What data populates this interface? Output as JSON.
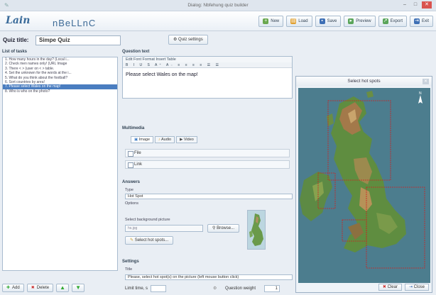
{
  "window": {
    "title": "Dialog: Nbfehung quiz builder"
  },
  "header": {
    "logo": "Lain",
    "logo_sub": "Nbfehung",
    "logo_word": "nBeLLnC"
  },
  "toolbar": [
    {
      "label": "New",
      "icon": "new-icon",
      "color": "#6aa84f"
    },
    {
      "label": "Load",
      "icon": "load-icon",
      "color": "#e0a030"
    },
    {
      "label": "Save",
      "icon": "save-icon",
      "color": "#3d6fb5"
    },
    {
      "label": "Preview",
      "icon": "preview-icon",
      "color": "#5aa55a"
    },
    {
      "label": "Export",
      "icon": "export-icon",
      "color": "#5aa55a"
    },
    {
      "label": "Exit",
      "icon": "exit-icon",
      "color": "#3d6fb5"
    }
  ],
  "quiz": {
    "title_label": "Quiz title:",
    "title_value": "Simpe Quiz",
    "settings_button": "Quiz settings"
  },
  "left": {
    "list_header": "List of tasks",
    "tasks": [
      "1. How many hours in the day? (Local i...",
      "2. Check men names only! (URL Image",
      "3. There < > (user on < > table.",
      "4. Set the unknown for the words at the i...",
      "5. What do you think about the football?",
      "6. Sort countries by area!",
      "7. Please select Wales on the map!",
      "8. Who is who on the photo?"
    ],
    "selected_index": 6,
    "buttons": {
      "add": "Add",
      "delete": "Delete"
    }
  },
  "question": {
    "header": "Question text",
    "menu": "Edit  Font  Format  Insert  Table",
    "tools": "B I U S A⁺ A₋ ≡ ≡ ≡ ≡ ☰ ☰",
    "text": "Please select Wales on the map!"
  },
  "multimedia": {
    "header": "Multimedia",
    "tabs": [
      "Image",
      "Audio",
      "Video"
    ],
    "file_label": "File",
    "link_label": "Link"
  },
  "answers": {
    "header": "Answers",
    "type_label": "Type",
    "type_value": "Hot Spot",
    "options_label": "Options",
    "bg_label": "Select background picture",
    "bg_file": "hs.jpg",
    "browse": "Browse...",
    "select_hotspots": "Select hot spots..."
  },
  "settings": {
    "header": "Settings",
    "title_label": "Title",
    "title_value": "Please, select hot spot(s) on the picture (left mouse button click)",
    "limit_label": "Limit time, s",
    "limit_value": "",
    "weight_label": "Question weight",
    "weight_value": "1"
  },
  "overlay": {
    "title": "Select hot spots",
    "clear": "Clear",
    "close": "Close"
  }
}
